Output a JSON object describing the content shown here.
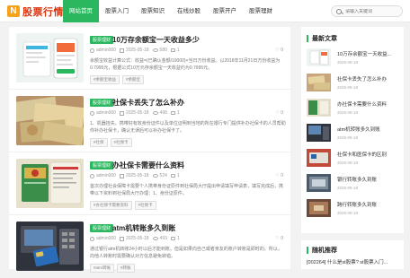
{
  "header": {
    "logo_mark": "N",
    "logo_text": "股票行情",
    "nav": [
      "网站首页",
      "股票入门",
      "股票知识",
      "在线炒股",
      "股票开户",
      "股票理财"
    ],
    "search_placeholder": "请输入关键词"
  },
  "articles": [
    {
      "badge": "股票理财",
      "title": "10万存余额宝一天收益多少",
      "author": "admin000",
      "date": "2025-05-18",
      "views": "580",
      "comments": "1",
      "likes": "0",
      "excerpt": "余额宝收益计算公式：收益=(已确认金额/10000)×当日万份收益。以2018年11月21日万份收益为0.7995元，根据公式10万元存余额宝一天收益约为0.7995元。",
      "tags": [
        "#余额宝收益",
        "#余额宝"
      ]
    },
    {
      "badge": "股票理财",
      "title": "社保卡丢失了怎么补办",
      "author": "admin000",
      "date": "2025-05-18",
      "views": "498",
      "comments": "1",
      "likes": "0",
      "excerpt": "1、机器挂失。携带好有效身份证件以及单位证明到当地的所在银行专门提供补办社保卡的人员帮助你补办社保卡，确认无误后可以补办社保卡了。",
      "tags": [
        "#社保",
        "#社保卡"
      ]
    },
    {
      "badge": "股票理财",
      "title": "办社保卡需要什么资料",
      "author": "admin000",
      "date": "2025-05-18",
      "views": "524",
      "comments": "1",
      "likes": "0",
      "excerpt": "首次办理社会保障卡需要个人携带身份证原件到社保局大厅提出申请填写申请表，填写完成后，携带以下资料到社保局大厅办理：1、身份证原件。",
      "tags": [
        "#办社保卡需要资料",
        "#社保卡"
      ]
    },
    {
      "badge": "股票理财",
      "title": "atm机转账多久到账",
      "author": "admin000",
      "date": "2025-05-18",
      "views": "493",
      "comments": "1",
      "likes": "0",
      "excerpt": "通过银行atm机转账24小时以后才能到账。但是如果向自己或者亲友的账户转账是即时的。所以，向他人转账时需要确认对方信息避免转错。",
      "tags": [
        "#atm转账",
        "#转账"
      ]
    }
  ],
  "sidebar": {
    "title": "最新文章",
    "items": [
      {
        "title": "10万存余额宝一天收益...",
        "date": "2025-05-18"
      },
      {
        "title": "社保卡丢失了怎么补办",
        "date": "2025-05-18"
      },
      {
        "title": "办社保卡需要什么资料",
        "date": "2025-05-18"
      },
      {
        "title": "atm机转账多久到账",
        "date": "2025-05-18"
      },
      {
        "title": "社保卡和医保卡的区别",
        "date": "2025-05-18"
      },
      {
        "title": "银行转账多久到账",
        "date": "2025-05-18"
      },
      {
        "title": "跨行转账多久到账",
        "date": "2025-05-18"
      }
    ]
  },
  "sidebar2": {
    "title": "随机推荐",
    "item": "[002264] 什么是st股票? st股票入门..."
  }
}
